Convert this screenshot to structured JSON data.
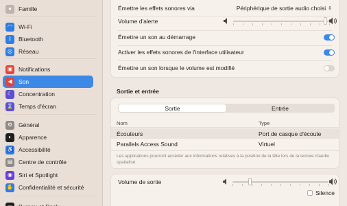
{
  "sidebar": {
    "items": [
      {
        "label": "Famille",
        "icon": "family-icon",
        "color": "#bdb5ae",
        "glyph": "●"
      },
      {
        "label": "Wi-Fi",
        "icon": "wifi-icon",
        "color": "#2f7de0",
        "glyph": "◠"
      },
      {
        "label": "Bluetooth",
        "icon": "bluetooth-icon",
        "color": "#2f7de0",
        "glyph": "ᛒ"
      },
      {
        "label": "Réseau",
        "icon": "network-icon",
        "color": "#2f7de0",
        "glyph": "◎"
      },
      {
        "label": "Notifications",
        "icon": "notifications-icon",
        "color": "#e2453c",
        "glyph": "▣"
      },
      {
        "label": "Son",
        "icon": "sound-icon",
        "color": "#e2453c",
        "glyph": "◀"
      },
      {
        "label": "Concentration",
        "icon": "focus-icon",
        "color": "#5c4fd1",
        "glyph": "☾"
      },
      {
        "label": "Temps d'écran",
        "icon": "screen-time-icon",
        "color": "#5c4fd1",
        "glyph": "⌛"
      },
      {
        "label": "Général",
        "icon": "general-icon",
        "color": "#8e8a87",
        "glyph": "⚙"
      },
      {
        "label": "Apparence",
        "icon": "appearance-icon",
        "color": "#1f1f1f",
        "glyph": "◐"
      },
      {
        "label": "Accessibilité",
        "icon": "accessibility-icon",
        "color": "#2f7de0",
        "glyph": "♿"
      },
      {
        "label": "Centre de contrôle",
        "icon": "control-center-icon",
        "color": "#8e8a87",
        "glyph": "▤"
      },
      {
        "label": "Siri et Spotlight",
        "icon": "siri-icon",
        "color": "#6b3fd6",
        "glyph": "◉"
      },
      {
        "label": "Confidentialité et sécurité",
        "icon": "privacy-icon",
        "color": "#2f7de0",
        "glyph": "✋"
      },
      {
        "label": "Bureau et Dock",
        "icon": "desktop-dock-icon",
        "color": "#1f1f1f",
        "glyph": "▭"
      }
    ],
    "selected_index": 5
  },
  "effects": {
    "play_via_label": "Émettre les effets sonores via",
    "play_via_value": "Périphérique de sortie audio choisi",
    "alert_volume_label": "Volume d'alerte",
    "alert_volume_level": 0.96,
    "startup_sound_label": "Émettre un son au démarrage",
    "startup_sound_on": true,
    "ui_effects_label": "Activer les effets sonores de l'interface utilisateur",
    "ui_effects_on": true,
    "volume_feedback_label": "Émettre un son lorsque le volume est modifié",
    "volume_feedback_on": false
  },
  "io": {
    "section_title": "Sortie et entrée",
    "tabs": [
      "Sortie",
      "Entrée"
    ],
    "active_tab": 0,
    "columns": [
      "Nom",
      "Type"
    ],
    "rows": [
      {
        "name": "Écouteurs",
        "type": "Port de casque d'écoute",
        "selected": true
      },
      {
        "name": "Parallels Access Sound",
        "type": "Virtuel",
        "selected": false
      }
    ],
    "note": "Les applications pourront accéder aux informations relatives à la position de la tête lors de la lecture d'audio spatialisé."
  },
  "output": {
    "volume_label": "Volume de sortie",
    "volume_level": 0.18,
    "mute_label": "Silence",
    "muted": false
  },
  "colors": {
    "accent": "#3d89e8"
  }
}
